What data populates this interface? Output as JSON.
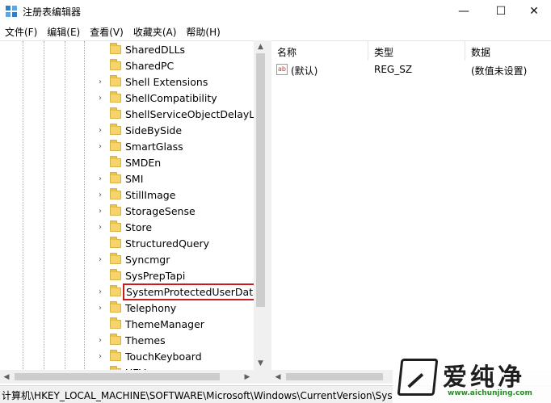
{
  "window": {
    "title": "注册表编辑器",
    "controls": {
      "minimize": "—",
      "maximize": "☐",
      "close": "✕"
    }
  },
  "menu": [
    "文件(F)",
    "编辑(E)",
    "查看(V)",
    "收藏夹(A)",
    "帮助(H)"
  ],
  "tree": [
    {
      "label": "SharedDLLs",
      "expandable": false
    },
    {
      "label": "SharedPC",
      "expandable": false
    },
    {
      "label": "Shell Extensions",
      "expandable": true
    },
    {
      "label": "ShellCompatibility",
      "expandable": true
    },
    {
      "label": "ShellServiceObjectDelayLoa",
      "expandable": false
    },
    {
      "label": "SideBySide",
      "expandable": true
    },
    {
      "label": "SmartGlass",
      "expandable": true
    },
    {
      "label": "SMDEn",
      "expandable": false
    },
    {
      "label": "SMI",
      "expandable": true
    },
    {
      "label": "StillImage",
      "expandable": true
    },
    {
      "label": "StorageSense",
      "expandable": true
    },
    {
      "label": "Store",
      "expandable": true
    },
    {
      "label": "StructuredQuery",
      "expandable": false
    },
    {
      "label": "Syncmgr",
      "expandable": true
    },
    {
      "label": "SysPrepTapi",
      "expandable": false
    },
    {
      "label": "SystemProtectedUserData",
      "expandable": true,
      "selected": true
    },
    {
      "label": "Telephony",
      "expandable": true
    },
    {
      "label": "ThemeManager",
      "expandable": false
    },
    {
      "label": "Themes",
      "expandable": true
    },
    {
      "label": "TouchKeyboard",
      "expandable": true
    },
    {
      "label": "UEV",
      "expandable": true
    }
  ],
  "list": {
    "columns": [
      "名称",
      "类型",
      "数据"
    ],
    "rows": [
      {
        "icon": "ab",
        "name": "(默认)",
        "type": "REG_SZ",
        "data": "(数值未设置)"
      }
    ]
  },
  "status": "计算机\\HKEY_LOCAL_MACHINE\\SOFTWARE\\Microsoft\\Windows\\CurrentVersion\\Sys",
  "watermark": {
    "text": "爱纯净",
    "url": "www.aichunjing.com"
  },
  "colors": {
    "highlight_border": "#cc1a1a",
    "folder": "#f5d46b"
  }
}
